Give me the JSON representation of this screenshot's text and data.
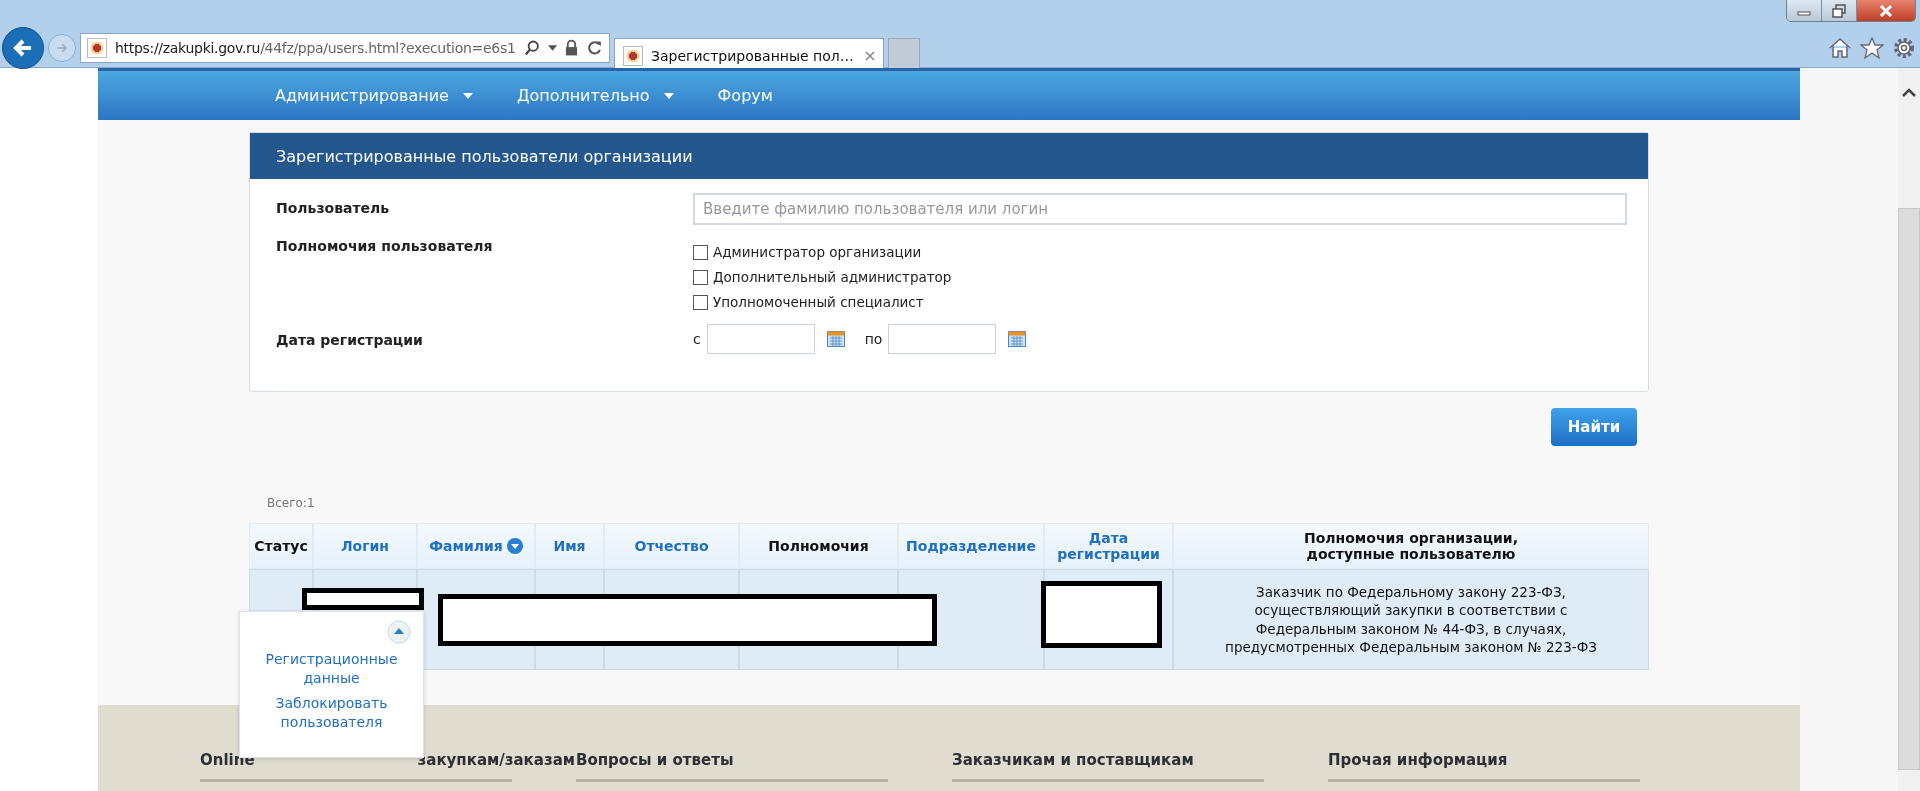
{
  "browser": {
    "url_host": "https://zakupki.gov.ru",
    "url_path": "/44fz/ppa/users.html?execution=e6s1",
    "tab_title": "Зарегистрированные пол…"
  },
  "nav": [
    {
      "label": "Администрирование",
      "has_dropdown": true
    },
    {
      "label": "Дополнительно",
      "has_dropdown": true
    },
    {
      "label": "Форум",
      "has_dropdown": false
    }
  ],
  "panel": {
    "title": "Зарегистрированные пользователи организации",
    "user_label": "Пользователь",
    "user_placeholder": "Введите фамилию пользователя или логин",
    "rights_label": "Полномочия пользователя",
    "rights": [
      {
        "label": "Администратор организации",
        "checked": false
      },
      {
        "label": "Дополнительный администратор",
        "checked": false
      },
      {
        "label": "Уполномоченный специалист",
        "checked": false
      }
    ],
    "date_label": "Дата регистрации",
    "date_from": "с",
    "date_to": "по"
  },
  "search_button": "Найти",
  "total": "Всего:1",
  "table": {
    "columns": [
      {
        "label": "Статус",
        "sortable": false,
        "sorted": false
      },
      {
        "label": "Логин",
        "sortable": true,
        "sorted": false
      },
      {
        "label": "Фамилия",
        "sortable": true,
        "sorted": true
      },
      {
        "label": "Имя",
        "sortable": true,
        "sorted": false
      },
      {
        "label": "Отчество",
        "sortable": true,
        "sorted": false
      },
      {
        "label": "Полномочия",
        "sortable": false,
        "sorted": false
      },
      {
        "label": "Подразделение",
        "sortable": true,
        "sorted": false
      },
      {
        "label": "Дата регистрации",
        "sortable": true,
        "sorted": false
      },
      {
        "label": "Полномочия организации, доступные пользователю",
        "sortable": false,
        "sorted": false
      }
    ],
    "rows": [
      {
        "cells": [
          "",
          "",
          "",
          "",
          "",
          "",
          "",
          "",
          "Заказчик по Федеральному закону 223-ФЗ, осуществляющий закупки в соответствии с Федеральным законом № 44-ФЗ, в случаях, предусмотренных Федеральным законом № 223-ФЗ"
        ]
      }
    ]
  },
  "row_menu": {
    "items": [
      "Регистрационные данные",
      "Заблокировать пользователя"
    ]
  },
  "footer": {
    "first_heading_start": "Online",
    "first_heading_end": "закупкам/заказам",
    "headings": [
      "Вопросы и ответы",
      "Заказчикам и поставщикам",
      "Прочая информация"
    ]
  }
}
